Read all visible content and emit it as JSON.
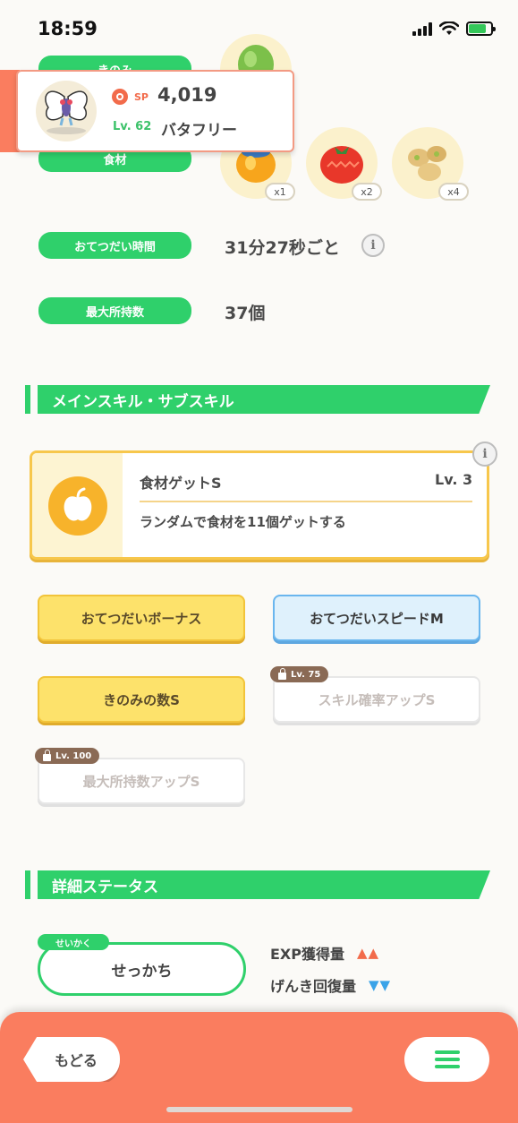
{
  "status_bar": {
    "time": "18:59"
  },
  "header_card": {
    "sp_label": "SP",
    "sp_value": "4,019",
    "level": "Lv. 62",
    "name": "バタフリー"
  },
  "berry_row": {
    "label": "きのみ"
  },
  "ingredients": {
    "label": "食材",
    "items": [
      {
        "icon": "honey-icon",
        "count": "x1"
      },
      {
        "icon": "tomato-icon",
        "count": "x2"
      },
      {
        "icon": "soybeans-icon",
        "count": "x4"
      }
    ]
  },
  "help_time": {
    "label": "おてつだい時間",
    "value": "31分27秒ごと"
  },
  "max_carry": {
    "label": "最大所持数",
    "value": "37個"
  },
  "skills_section": {
    "title": "メインスキル・サブスキル",
    "main_skill": {
      "name": "食材ゲットS",
      "level": "Lv. 3",
      "description": "ランダムで食材を11個ゲットする"
    },
    "sub_skills": [
      {
        "label": "おてつだいボーナス",
        "style": "yellow"
      },
      {
        "label": "おてつだいスピードM",
        "style": "blue"
      },
      {
        "label": "きのみの数S",
        "style": "yellow"
      },
      {
        "label": "スキル確率アップS",
        "style": "locked",
        "unlock": "Lv. 75"
      },
      {
        "label": "最大所持数アップS",
        "style": "locked",
        "unlock": "Lv. 100"
      }
    ]
  },
  "details_section": {
    "title": "詳細ステータス",
    "nature_tag": "せいかく",
    "nature": "せっかち",
    "stats": [
      {
        "label": "EXP獲得量",
        "arrows": "▲▲",
        "color": "#f26b4b"
      },
      {
        "label": "げんき回復量",
        "arrows": "▼▼",
        "color": "#3aa3e8"
      }
    ]
  },
  "bottom_bar": {
    "back_label": "もどる"
  },
  "colors": {
    "accent_green": "#2fd06b",
    "accent_orange": "#fa7d5f",
    "skill_yellow": "#f7c74c"
  }
}
